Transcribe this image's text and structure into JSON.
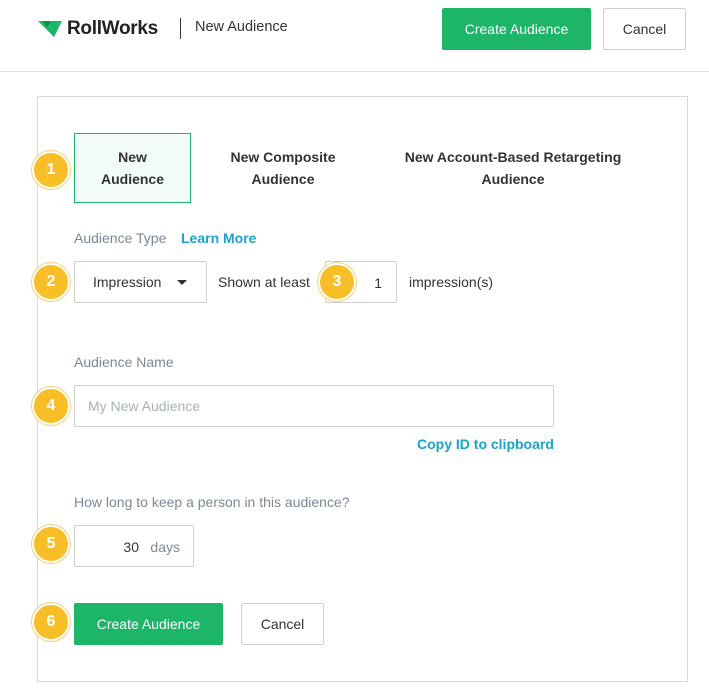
{
  "header": {
    "logo_text": "RollWorks",
    "title": "New Audience",
    "create_label": "Create Audience",
    "cancel_label": "Cancel"
  },
  "tabs": [
    {
      "label": "New Audience",
      "active": true
    },
    {
      "label": "New Composite Audience",
      "active": false
    },
    {
      "label": "New Account-Based Retargeting Audience",
      "active": false
    }
  ],
  "audience_type": {
    "label": "Audience Type",
    "learn_more": "Learn More",
    "selected": "Impression",
    "shown_at_least": "Shown at least",
    "count": "1",
    "unit": "impression(s)"
  },
  "audience_name": {
    "label": "Audience Name",
    "placeholder": "My New Audience",
    "value": "",
    "copy_link": "Copy ID to clipboard"
  },
  "duration": {
    "label": "How long to keep a person in this audience?",
    "value": "30",
    "unit": "days"
  },
  "footer": {
    "create_label": "Create Audience",
    "cancel_label": "Cancel"
  },
  "badges": [
    "1",
    "2",
    "3",
    "4",
    "5",
    "6"
  ],
  "colors": {
    "brand_green": "#1db568",
    "link_blue": "#1aa3c9",
    "badge_yellow": "#f7be27",
    "label_gray": "#7c8896"
  },
  "icons": {
    "logo": "rollworks-logo-icon",
    "dropdown": "caret-down-icon"
  }
}
